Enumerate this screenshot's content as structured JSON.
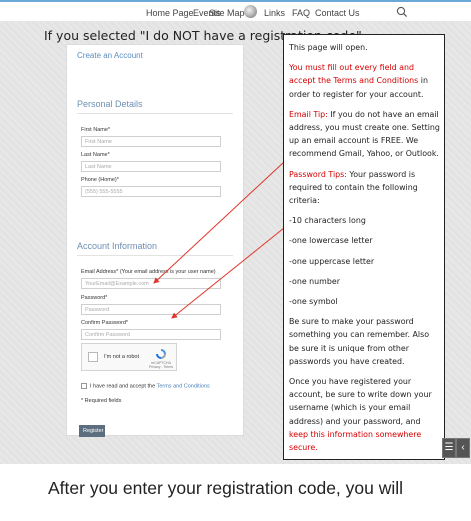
{
  "nav": {
    "items": [
      "Home Page",
      "Events",
      "Site Map",
      "Links",
      "FAQ",
      "Contact Us"
    ]
  },
  "heading": "If you selected \"I do NOT have a registration code\"…",
  "form": {
    "title_link": "Create an Account",
    "personal_section": "Personal Details",
    "first_name_label": "First Name*",
    "first_name_placeholder": "First Name",
    "last_name_label": "Last Name*",
    "last_name_placeholder": "Last Name",
    "phone_label": "Phone (Home)*",
    "phone_placeholder": "(555) 555-5555",
    "account_section": "Account Information",
    "email_label": "Email Address* (Your email address is your user name)",
    "email_placeholder": "YourEmail@Example.com",
    "password_label": "Password*",
    "password_placeholder": "Password",
    "confirm_label": "Confirm Password*",
    "confirm_placeholder": "Confirm Password",
    "captcha_text": "I'm not a robot",
    "captcha_brand": "reCAPTCHA",
    "captcha_links": "Privacy - Terms",
    "terms_prefix": "I have read and accept the ",
    "terms_link": "Terms and Conditions",
    "required_note": "* Required fields",
    "register_button": "Register"
  },
  "callout": {
    "open": "This page will open.",
    "must_fill_red": "You must fill out every field and accept the Terms and Conditions",
    "must_fill_rest": " in order to register for your account.",
    "email_tip_label": "Email Tip:",
    "email_tip_text": " If you do not have an email address, you must create one. Setting up an email account is FREE. We recommend Gmail, Yahoo, or Outlook.",
    "password_tips_label": "Password Tips:",
    "password_tips_text": " Your password is required to contain the following criteria:",
    "criteria": [
      "-10 characters long",
      "-one lowercase letter",
      "-one uppercase letter",
      "-one number",
      "-one symbol"
    ],
    "remember": "Be sure to make your password something you can remember. Also be sure it is unique from other passwords you have created.",
    "registered_text": "Once you have registered your account, be sure to write down your username (which is your email address) and your password, and ",
    "registered_red": "keep this information somewhere secure."
  },
  "controls": {
    "menu_glyph": "☰",
    "back_glyph": "‹"
  },
  "bottom_text": "After you enter your registration code, you will",
  "colors": {
    "callout_red": "#d40000",
    "section_blue": "#6d8fb3",
    "nav_accent": "#6aa9d6"
  }
}
